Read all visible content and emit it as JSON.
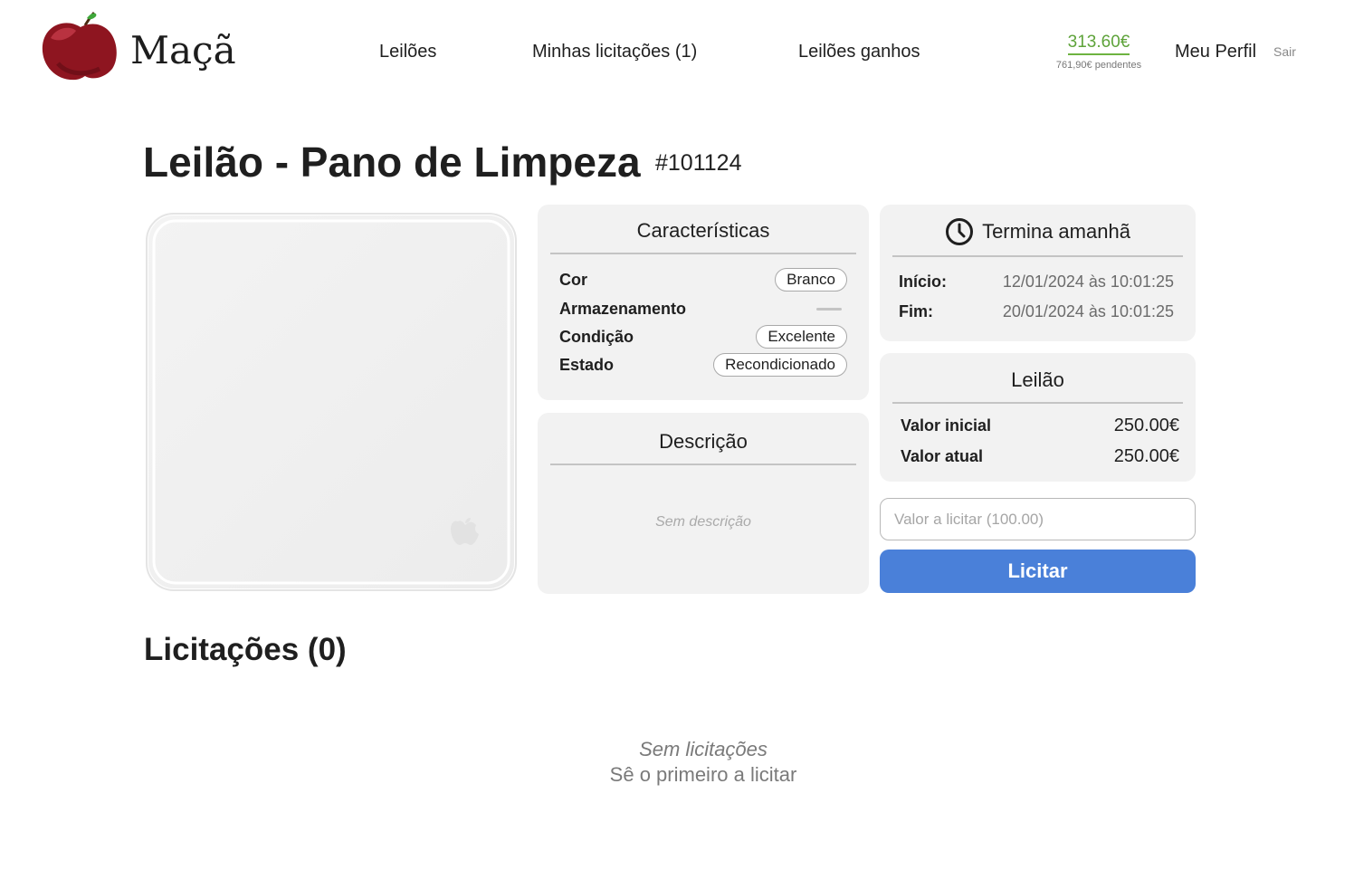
{
  "header": {
    "brand": "Maçã",
    "nav": [
      {
        "label": "Leilões"
      },
      {
        "label": "Minhas licitações (1)"
      },
      {
        "label": "Leilões ganhos"
      }
    ],
    "balance": "313.60€",
    "pending": "761,90€ pendentes",
    "profile_label": "Meu Perfil",
    "logout_label": "Sair"
  },
  "auction": {
    "title": "Leilão - Pano de Limpeza",
    "id": "#101124"
  },
  "specs": {
    "title": "Características",
    "rows": [
      {
        "label": "Cor",
        "value": "Branco"
      },
      {
        "label": "Armazenamento",
        "value": ""
      },
      {
        "label": "Condição",
        "value": "Excelente"
      },
      {
        "label": "Estado",
        "value": "Recondicionado"
      }
    ]
  },
  "description": {
    "title": "Descrição",
    "empty_text": "Sem descrição"
  },
  "timing": {
    "title": "Termina amanhã",
    "icon": "clock-icon",
    "start_label": "Início:",
    "start_value": "12/01/2024 às 10:01:25",
    "end_label": "Fim:",
    "end_value": "20/01/2024 às 10:01:25"
  },
  "pricing": {
    "title": "Leilão",
    "initial_label": "Valor inicial",
    "initial_value": "250.00€",
    "current_label": "Valor atual",
    "current_value": "250.00€"
  },
  "bid_form": {
    "placeholder": "Valor a licitar (100.00)",
    "value": "",
    "button_label": "Licitar"
  },
  "bids": {
    "title": "Licitações (0)",
    "empty_title": "Sem licitações",
    "empty_cta": "Sê o primeiro a licitar"
  },
  "colors": {
    "accent_blue": "#4a80d9",
    "balance_green": "#5ea33a",
    "card_bg": "#f2f2f2",
    "logo_red": "#8e1520"
  }
}
